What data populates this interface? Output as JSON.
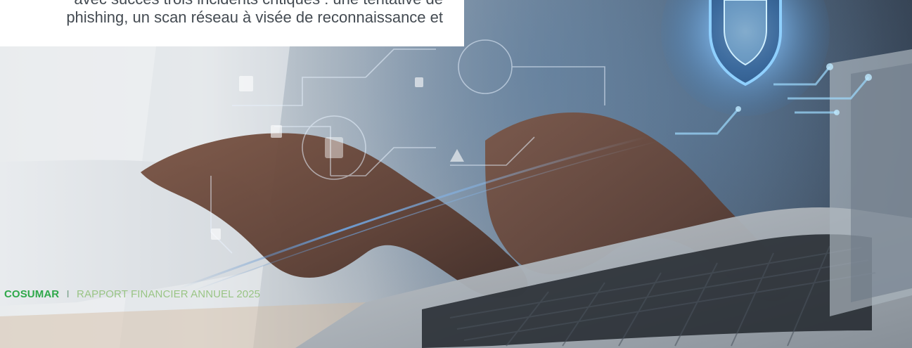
{
  "document": {
    "text_lines": [
      "avec succès trois incidents critiques : une tentative de",
      "phishing, un scan réseau à visée de reconnaissance et"
    ],
    "footer": {
      "brand": "COSUMAR",
      "separator": "I",
      "title": "RAPPORT FINANCIER ANNUEL 2025"
    },
    "image": {
      "subject": "Hands typing on a laptop with a cybersecurity shield overlay"
    }
  }
}
